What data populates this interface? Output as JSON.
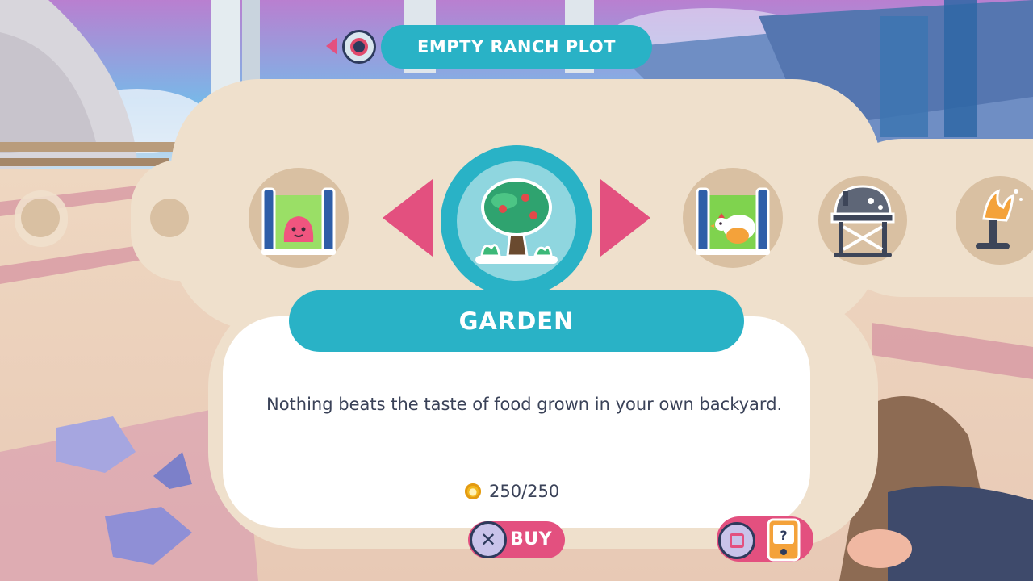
{
  "header": {
    "title": "EMPTY RANCH PLOT"
  },
  "carousel": {
    "items": [
      {
        "id": "corral",
        "icon": "corral-pink-slime-icon"
      },
      {
        "id": "garden",
        "icon": "garden-tree-icon",
        "selected": true
      },
      {
        "id": "coop",
        "icon": "coop-chicken-icon"
      },
      {
        "id": "silo",
        "icon": "silo-icon"
      },
      {
        "id": "incinerator",
        "icon": "incinerator-icon"
      }
    ]
  },
  "selection": {
    "name": "GARDEN",
    "description": "Nothing beats the taste of food grown in your own backyard.",
    "price": "250/250"
  },
  "actions": {
    "buy_label": "BUY",
    "buy_glyph": "✕",
    "info_icon": "slimepedia-icon"
  },
  "colors": {
    "accent_teal": "#29b2c6",
    "accent_pink": "#e3507f",
    "panel_beige": "#efe0cc",
    "slot_tan": "#d9c0a2",
    "text_dark": "#3a4258",
    "coin_gold": "#f2b81f"
  }
}
